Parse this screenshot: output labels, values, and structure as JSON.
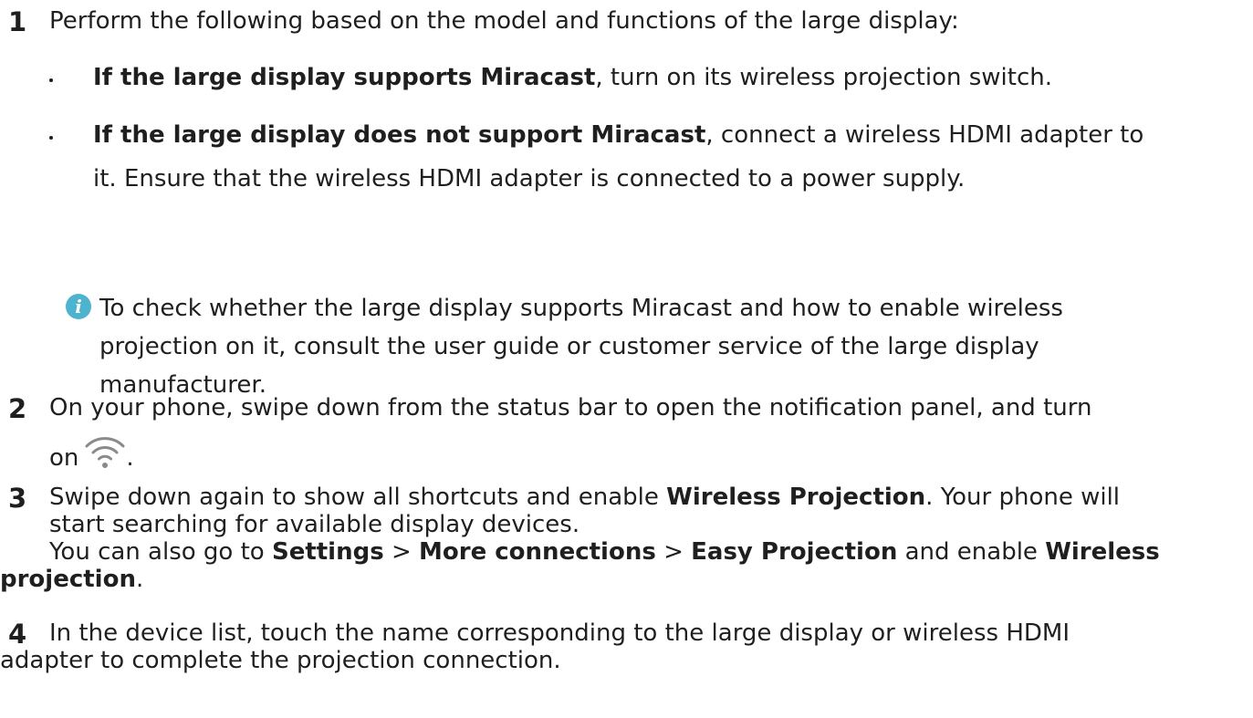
{
  "steps": [
    {
      "number": "1",
      "text": "Perform the following based on the model and functions of the large display:",
      "bullets": [
        {
          "bold": "If the large display supports Miracast",
          "text": ", turn on its wireless projection switch."
        },
        {
          "bold": "If the large display does not support Miracast",
          "text_line1": ", connect a wireless HDMI adapter to",
          "text_line2": "it. Ensure that the wireless HDMI adapter is connected to a power supply."
        }
      ],
      "note": {
        "icon": "info-icon",
        "line1": "To check whether the large display supports Miracast and how to enable wireless",
        "line2": "projection on it, consult the user guide or customer service of the large display",
        "line3": "manufacturer."
      }
    },
    {
      "number": "2",
      "line1": "On your phone, swipe down from the status bar to open the notification panel, and turn",
      "line2_prefix": "on",
      "icon": "wifi-icon",
      "line2_suffix": "."
    },
    {
      "number": "3",
      "line1_prefix": "Swipe down again to show all shortcuts and enable ",
      "line1_bold": "Wireless Projection",
      "line1_suffix": ". Your phone will",
      "line2": "start searching for available display devices.",
      "line3_prefix": "You can also go to ",
      "line3_bold1": "Settings",
      "line3_sep1": " > ",
      "line3_bold2": "More connections",
      "line3_sep2": " > ",
      "line3_bold3": "Easy Projection",
      "line3_mid": " and enable ",
      "line3_bold4": "Wireless",
      "line4_bold": "projection",
      "line4_suffix": "."
    },
    {
      "number": "4",
      "line1": "In the device list, touch the name corresponding to the large display or wireless HDMI",
      "line2": "adapter to complete the projection connection."
    }
  ],
  "colors": {
    "text": "#1f1f1f",
    "info_icon": "#4eb3ce",
    "wifi_icon": "#8a8a8a"
  }
}
